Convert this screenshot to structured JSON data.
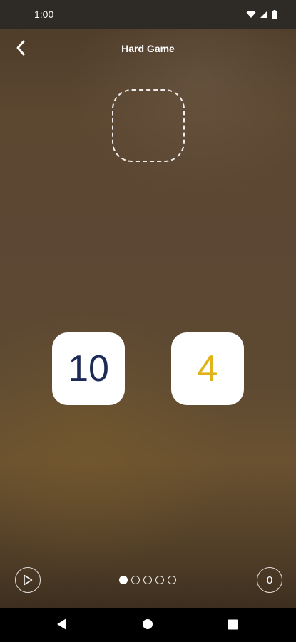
{
  "status": {
    "time": "1:00",
    "icons": [
      "wifi-icon",
      "signal-icon",
      "battery-icon"
    ]
  },
  "header": {
    "title": "Hard Game",
    "back_icon": "chevron-left-icon"
  },
  "game": {
    "drop_target": "empty-answer-slot",
    "tiles": [
      {
        "value": "10",
        "color": "#1c2a57"
      },
      {
        "value": "4",
        "color": "#e0b31a"
      }
    ]
  },
  "controls": {
    "play_icon": "play-icon",
    "page_count": 5,
    "active_page": 1,
    "score": "0"
  },
  "nav": {
    "buttons": [
      "back-triangle-icon",
      "home-circle-icon",
      "recents-square-icon"
    ]
  },
  "colors": {
    "background": "#5b4733",
    "tile": "#ffffff",
    "navbar": "#000000",
    "statusbar": "#2e2a26"
  }
}
